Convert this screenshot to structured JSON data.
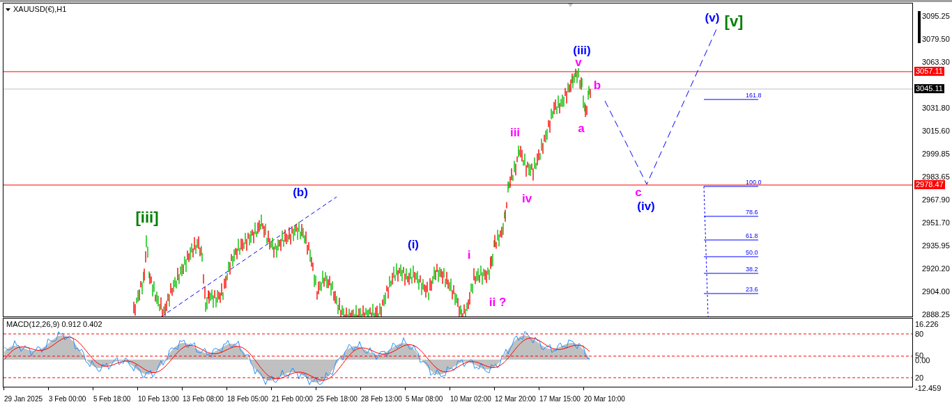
{
  "chart": {
    "title": "XAUUSD(€),H1"
  },
  "price_axis": [
    "3095.25",
    "3079.50",
    "3063.30",
    "3031.80",
    "3015.60",
    "2999.85",
    "2983.65",
    "2967.90",
    "2951.70",
    "2935.95",
    "2920.20",
    "2904.00",
    "2888.25"
  ],
  "time_axis": [
    "29 Jan 2025",
    "3 Feb 00:00",
    "5 Feb 18:00",
    "10 Feb 13:00",
    "13 Feb 08:00",
    "18 Feb 05:00",
    "21 Feb 00:00",
    "25 Feb 18:00",
    "28 Feb 13:00",
    "5 Mar 08:00",
    "10 Mar 02:00",
    "12 Mar 20:00",
    "17 Mar 15:00",
    "20 Mar 10:00"
  ],
  "levels": [
    {
      "tag": "3057.11",
      "color": "#ff0000"
    },
    {
      "tag": "3045.11",
      "color": "#000000"
    },
    {
      "tag": "2978.47",
      "color": "#ff0000"
    }
  ],
  "fibonacci": [
    "161.8",
    "100.0",
    "78.6",
    "61.8",
    "50.0",
    "38.2",
    "23.6"
  ],
  "wave_labels": [
    {
      "text": "[iii]",
      "color": "#008000"
    },
    {
      "text": "(b)",
      "color": "#0000ff"
    },
    {
      "text": "(i)",
      "color": "#0000ff"
    },
    {
      "text": "i",
      "color": "#ff00ff"
    },
    {
      "text": "ii ?",
      "color": "#ff00ff"
    },
    {
      "text": "iii",
      "color": "#ff00ff"
    },
    {
      "text": "iv",
      "color": "#ff00ff"
    },
    {
      "text": "(iii)",
      "color": "#0000ff"
    },
    {
      "text": "v",
      "color": "#ff00ff"
    },
    {
      "text": "a",
      "color": "#ff00ff"
    },
    {
      "text": "b",
      "color": "#ff00ff"
    },
    {
      "text": "c",
      "color": "#ff00ff"
    },
    {
      "text": "(iv)",
      "color": "#0000ff"
    },
    {
      "text": "(v)",
      "color": "#0000ff"
    },
    {
      "text": "[v]",
      "color": "#008000"
    }
  ],
  "macd": {
    "title": "MACD(12,26,9) 0.912 0.402",
    "scale": [
      "16.226",
      "80",
      "50",
      "0.00",
      "20",
      "-12.459"
    ]
  }
}
